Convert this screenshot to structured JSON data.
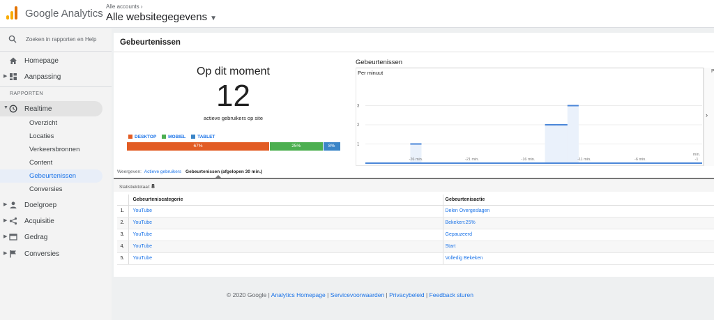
{
  "header": {
    "product_name": "Google Analytics",
    "account_crumb": "Alle accounts",
    "property_name": "Alle websitegegevens"
  },
  "sidebar": {
    "search_placeholder": "Zoeken in rapporten en Help",
    "top_items": [
      {
        "label": "Homepage",
        "icon": "home-icon"
      },
      {
        "label": "Aanpassing",
        "icon": "dashboard-grid-icon"
      }
    ],
    "section_label": "RAPPORTEN",
    "realtime": {
      "label": "Realtime",
      "icon": "clock-icon",
      "children": [
        "Overzicht",
        "Locaties",
        "Verkeersbronnen",
        "Content",
        "Gebeurtenissen",
        "Conversies"
      ],
      "selected": "Gebeurtenissen"
    },
    "bottom_items": [
      {
        "label": "Doelgroep",
        "icon": "person-icon"
      },
      {
        "label": "Acquisitie",
        "icon": "acquisition-icon"
      },
      {
        "label": "Gedrag",
        "icon": "behavior-window-icon"
      },
      {
        "label": "Conversies",
        "icon": "flag-icon"
      }
    ]
  },
  "main": {
    "title": "Gebeurtenissen",
    "now": {
      "title": "Op dit moment",
      "count": "12",
      "subtitle": "actieve gebruikers op site"
    },
    "devices": [
      {
        "label": "DESKTOP",
        "share": 67,
        "value_label": "67%",
        "color": "#e25c24"
      },
      {
        "label": "MOBIEL",
        "share": 25,
        "value_label": "25%",
        "color": "#4caf50"
      },
      {
        "label": "TABLET",
        "share": 8,
        "value_label": "8%",
        "color": "#3b85c7"
      }
    ],
    "view_tabs": {
      "prefix": "Weergeven:",
      "link": "Actieve gebruikers",
      "current": "Gebeurtenissen (afgelopen 30 min.)"
    },
    "stat_label": "Statistiektotaal:",
    "stat_value": "8",
    "table": {
      "headers": [
        "Gebeurteniscategorie",
        "Gebeurtenisactie"
      ],
      "rows": [
        {
          "idx": "1.",
          "category": "YouTube",
          "action": "Delen Overgeslagen"
        },
        {
          "idx": "2.",
          "category": "YouTube",
          "action": "Bekeken:25%"
        },
        {
          "idx": "3.",
          "category": "YouTube",
          "action": "Gepauzeerd"
        },
        {
          "idx": "4.",
          "category": "YouTube",
          "action": "Start"
        },
        {
          "idx": "5.",
          "category": "YouTube",
          "action": "Volledig Bekeken"
        }
      ]
    }
  },
  "chart_data": {
    "type": "area",
    "title": "Gebeurtenissen",
    "ylabel": "Per minuut",
    "ylim": [
      0,
      3
    ],
    "yticks": [
      "1",
      "2",
      "3"
    ],
    "x_labels": [
      "-26 min.",
      "-21 min.",
      "-16 min.",
      "-11 min.",
      "-6 min.",
      "-1"
    ],
    "x_extra_label": "min.",
    "minutes_ago": [
      -30,
      -29,
      -28,
      -27,
      -26,
      -25,
      -24,
      -23,
      -22,
      -21,
      -20,
      -19,
      -18,
      -17,
      -16,
      -15,
      -14,
      -13,
      -12,
      -11,
      -10,
      -9,
      -8,
      -7,
      -6,
      -5,
      -4,
      -3,
      -2,
      -1
    ],
    "values": [
      0,
      0,
      0,
      0,
      1,
      0,
      0,
      0,
      0,
      0,
      0,
      0,
      0,
      0,
      0,
      0,
      2,
      2,
      3,
      0,
      0,
      0,
      0,
      0,
      0,
      0,
      0,
      0,
      0,
      0
    ],
    "right_panel_label": "P"
  },
  "footer": {
    "copyright": "© 2020 Google",
    "links": [
      "Analytics Homepage",
      "Servicevoorwaarden",
      "Privacybeleid",
      "Feedback sturen"
    ],
    "separator": " | "
  }
}
